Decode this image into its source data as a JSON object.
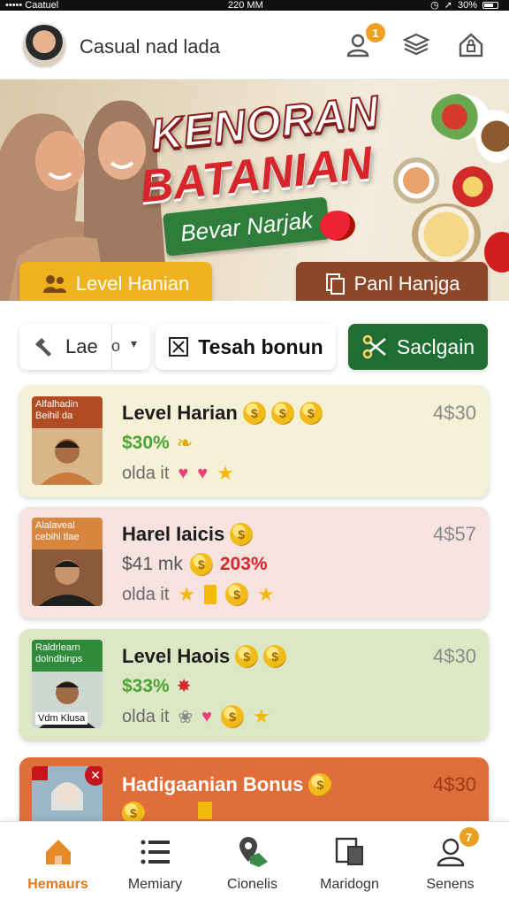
{
  "status_bar": {
    "carrier": "••••• Caatuel",
    "time": "220 MM",
    "battery": "30%"
  },
  "header": {
    "title": "Casual nad lada",
    "profile_badge": "1"
  },
  "banner": {
    "title_line1": "KENORAN",
    "title_line2": "BATANIAN",
    "pill": "Bevar Narjak",
    "btn_level": "Level Hanian",
    "btn_panl": "Panl Hanjga"
  },
  "filters": {
    "sort_label": "Lae",
    "sort_suffix": "o",
    "tesah": "Tesah bonun",
    "sacl": "Saclgain"
  },
  "cards": [
    {
      "caption": "Alfalhadin Beihil da",
      "name": "Level Harian",
      "pct": "$30%",
      "sub": "olda it",
      "num": "4$30",
      "bg": "#f4f1d6"
    },
    {
      "caption": "Alalaveal cebihl tlae",
      "name": "Harel Iaicis",
      "pct_prefix": "$41 mk",
      "pct": "203%",
      "sub": "olda it",
      "num": "4$57",
      "bg": "#f6e3e0"
    },
    {
      "caption": "Raldrlearn dolndbinps",
      "caption2": "Vdm Klusa",
      "name": "Level Haois",
      "pct": "$33%",
      "sub": "olda it",
      "num": "4$30",
      "bg": "#dde7c3"
    },
    {
      "name": "Hadigaanian Bonus",
      "num": "4$30",
      "bg": "#e06e3a"
    }
  ],
  "tabbar": [
    {
      "label": "Hemaurs",
      "icon": "home-icon"
    },
    {
      "label": "Memiary",
      "icon": "list-icon"
    },
    {
      "label": "Cionelis",
      "icon": "map-pin-icon"
    },
    {
      "label": "Maridogn",
      "icon": "devices-icon"
    },
    {
      "label": "Senens",
      "icon": "user-icon",
      "badge": "7"
    }
  ],
  "colors": {
    "accent_orange": "#e07a1c",
    "gold": "#f0b21e",
    "brown": "#8b4727",
    "green": "#1f6e34",
    "red": "#d6262b"
  }
}
